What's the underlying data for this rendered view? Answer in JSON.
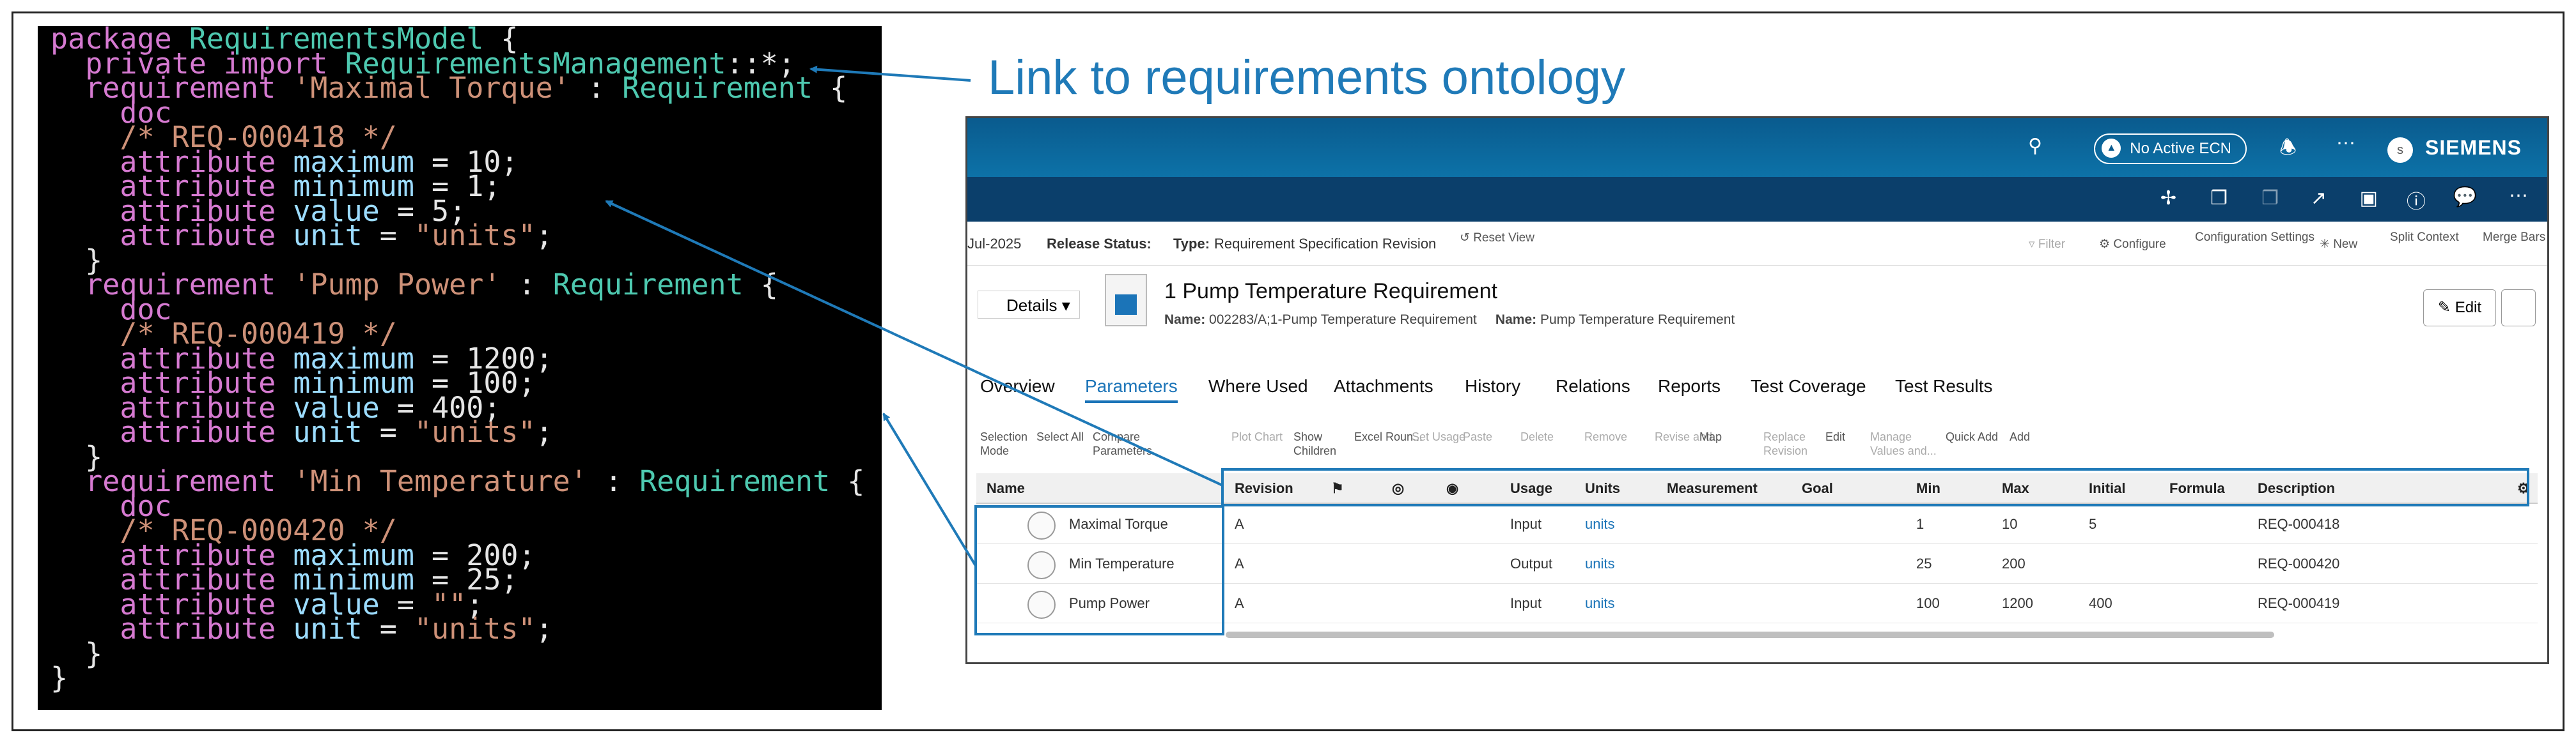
{
  "code": {
    "lines": [
      [
        [
          "kw",
          "package "
        ],
        [
          "ty",
          "RequirementsModel"
        ],
        [
          "pl",
          " {"
        ]
      ],
      [
        [
          "pl",
          "  "
        ],
        [
          "kw",
          "private import "
        ],
        [
          "ty",
          "RequirementsManagement"
        ],
        [
          "pl",
          "::*;"
        ]
      ],
      [
        [
          "pl",
          "  "
        ],
        [
          "kw",
          "requirement "
        ],
        [
          "st",
          "'Maximal Torque'"
        ],
        [
          "pl",
          " : "
        ],
        [
          "ty",
          "Requirement"
        ],
        [
          "pl",
          " {"
        ]
      ],
      [
        [
          "pl",
          "    "
        ],
        [
          "kw",
          "doc"
        ]
      ],
      [
        [
          "pl",
          "    "
        ],
        [
          "cm",
          "/* REQ-000418 */"
        ]
      ],
      [
        [
          "pl",
          "    "
        ],
        [
          "kw",
          "attribute "
        ],
        [
          "id",
          "maximum"
        ],
        [
          "pl",
          " = 10;"
        ]
      ],
      [
        [
          "pl",
          "    "
        ],
        [
          "kw",
          "attribute "
        ],
        [
          "id",
          "minimum"
        ],
        [
          "pl",
          " = 1;"
        ]
      ],
      [
        [
          "pl",
          "    "
        ],
        [
          "kw",
          "attribute "
        ],
        [
          "id",
          "value"
        ],
        [
          "pl",
          " = 5;"
        ]
      ],
      [
        [
          "pl",
          "    "
        ],
        [
          "kw",
          "attribute "
        ],
        [
          "id",
          "unit"
        ],
        [
          "pl",
          " = "
        ],
        [
          "st",
          "\"units\""
        ],
        [
          "pl",
          ";"
        ]
      ],
      [
        [
          "pl",
          "  }"
        ]
      ],
      [
        [
          "pl",
          "  "
        ],
        [
          "kw",
          "requirement "
        ],
        [
          "st",
          "'Pump Power'"
        ],
        [
          "pl",
          " : "
        ],
        [
          "ty",
          "Requirement"
        ],
        [
          "pl",
          " {"
        ]
      ],
      [
        [
          "pl",
          "    "
        ],
        [
          "kw",
          "doc"
        ]
      ],
      [
        [
          "pl",
          "    "
        ],
        [
          "cm",
          "/* REQ-000419 */"
        ]
      ],
      [
        [
          "pl",
          "    "
        ],
        [
          "kw",
          "attribute "
        ],
        [
          "id",
          "maximum"
        ],
        [
          "pl",
          " = 1200;"
        ]
      ],
      [
        [
          "pl",
          "    "
        ],
        [
          "kw",
          "attribute "
        ],
        [
          "id",
          "minimum"
        ],
        [
          "pl",
          " = 100;"
        ]
      ],
      [
        [
          "pl",
          "    "
        ],
        [
          "kw",
          "attribute "
        ],
        [
          "id",
          "value"
        ],
        [
          "pl",
          " = 400;"
        ]
      ],
      [
        [
          "pl",
          "    "
        ],
        [
          "kw",
          "attribute "
        ],
        [
          "id",
          "unit"
        ],
        [
          "pl",
          " = "
        ],
        [
          "st",
          "\"units\""
        ],
        [
          "pl",
          ";"
        ]
      ],
      [
        [
          "pl",
          "  }"
        ]
      ],
      [
        [
          "pl",
          "  "
        ],
        [
          "kw",
          "requirement "
        ],
        [
          "st",
          "'Min Temperature'"
        ],
        [
          "pl",
          " : "
        ],
        [
          "ty",
          "Requirement"
        ],
        [
          "pl",
          " {"
        ]
      ],
      [
        [
          "pl",
          "    "
        ],
        [
          "kw",
          "doc"
        ]
      ],
      [
        [
          "pl",
          "    "
        ],
        [
          "cm",
          "/* REQ-000420 */"
        ]
      ],
      [
        [
          "pl",
          "    "
        ],
        [
          "kw",
          "attribute "
        ],
        [
          "id",
          "maximum"
        ],
        [
          "pl",
          " = 200;"
        ]
      ],
      [
        [
          "pl",
          "    "
        ],
        [
          "kw",
          "attribute "
        ],
        [
          "id",
          "minimum"
        ],
        [
          "pl",
          " = 25;"
        ]
      ],
      [
        [
          "pl",
          "    "
        ],
        [
          "kw",
          "attribute "
        ],
        [
          "id",
          "value"
        ],
        [
          "pl",
          " = "
        ],
        [
          "st",
          "\"\""
        ],
        [
          "pl",
          ";"
        ]
      ],
      [
        [
          "pl",
          "    "
        ],
        [
          "kw",
          "attribute "
        ],
        [
          "id",
          "unit"
        ],
        [
          "pl",
          " = "
        ],
        [
          "st",
          "\"units\""
        ],
        [
          "pl",
          ";"
        ]
      ],
      [
        [
          "pl",
          "  }"
        ]
      ],
      [
        [
          "pl",
          "}"
        ]
      ]
    ]
  },
  "callout": "Link to requirements ontology",
  "app": {
    "ecn_label": "No Active ECN",
    "brand": "SIEMENS",
    "avatar_initial": "s",
    "status": {
      "date_fragment": "Jul-2025",
      "release_status_label": "Release Status:",
      "type_label": "Type:",
      "type_value": "Requirement Specification Revision",
      "reset_view": "Reset View",
      "filter": "Filter",
      "configure": "Configure",
      "configuration_settings": "Configuration Settings",
      "new": "New",
      "split_context": "Split Context",
      "merge_bars": "Merge Bars"
    },
    "details_label": "Details",
    "object_title": "1 Pump Temperature Requirement",
    "name1_label": "Name:",
    "name1_value": "002283/A;1-Pump Temperature Requirement",
    "name2_label": "Name:",
    "name2_value": "Pump Temperature Requirement",
    "edit_label": "Edit",
    "tabs": [
      "Overview",
      "Parameters",
      "Where Used",
      "Attachments",
      "History",
      "Relations",
      "Reports",
      "Test Coverage",
      "Test Results"
    ],
    "tools": [
      "Selection Mode",
      "Select All",
      "Compare Parameters",
      "Plot Chart",
      "Show Children",
      "Excel Roun...",
      "Set Usage",
      "Paste",
      "Delete",
      "Remove",
      "Revise and...",
      "Map",
      "Replace Revision",
      "Edit",
      "Manage Values and...",
      "Quick Add",
      "Add"
    ],
    "columns": [
      "Name",
      "Revision",
      "",
      "",
      "",
      "Usage",
      "Units",
      "Measurement",
      "Goal",
      "Min",
      "Max",
      "Initial",
      "Formula",
      "Description"
    ],
    "rows": [
      {
        "name": "Maximal Torque",
        "revision": "A",
        "usage": "Input",
        "units": "units",
        "min": "1",
        "max": "10",
        "initial": "5",
        "description": "REQ-000418"
      },
      {
        "name": "Min Temperature",
        "revision": "A",
        "usage": "Output",
        "units": "units",
        "min": "25",
        "max": "200",
        "initial": "",
        "description": "REQ-000420"
      },
      {
        "name": "Pump Power",
        "revision": "A",
        "usage": "Input",
        "units": "units",
        "min": "100",
        "max": "1200",
        "initial": "400",
        "description": "REQ-000419"
      }
    ]
  },
  "colors": {
    "accent": "#1f7ab8",
    "header_top": "#0d72a8",
    "header_second": "#0b3f6b"
  }
}
